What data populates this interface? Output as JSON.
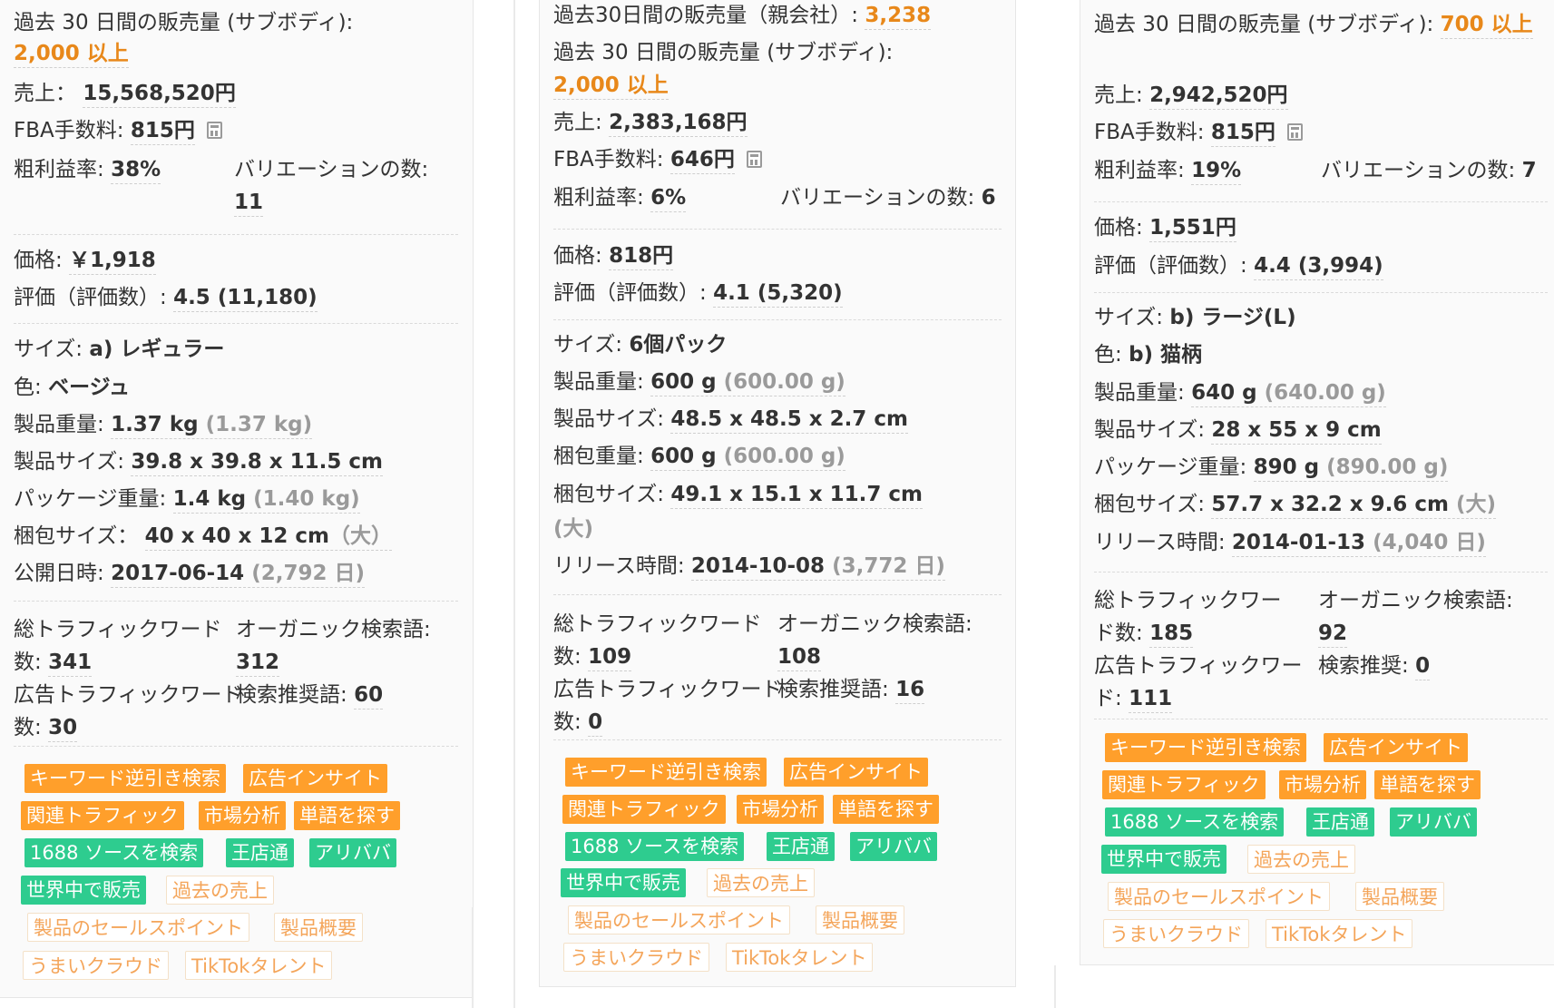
{
  "card1": {
    "sales30_label": "過去 30 日間の販売量 (サブボディ):",
    "sales30_value": "2,000 以上",
    "revenue_label": "売上：",
    "revenue_value": "15,568,520円",
    "fba_label": "FBA手数料:",
    "fba_value": "815円",
    "margin_label": "粗利益率:",
    "margin_value": "38%",
    "variations_label": "バリエーションの数:",
    "variations_value": "11",
    "price_label": "価格:",
    "price_value": "￥1,918",
    "rating_label": "評価（評価数）:",
    "rating_value": "4.5 (11,180)",
    "size_label": "サイズ:",
    "size_value": "a) レギュラー",
    "color_label": "色:",
    "color_value": "ベージュ",
    "weight_label": "製品重量:",
    "weight_value": "1.37 kg",
    "weight_extra": "(1.37 kg)",
    "dims_label": "製品サイズ:",
    "dims_value": "39.8 x 39.8 x 11.5 cm",
    "pkg_weight_label": "パッケージ重量:",
    "pkg_weight_value": "1.4 kg",
    "pkg_weight_extra": "(1.40 kg)",
    "pkg_size_label": "梱包サイズ：",
    "pkg_size_value": "40 x 40 x 12 cm",
    "pkg_size_extra": "（大）",
    "date_label": "公開日時:",
    "date_value": "2017-06-14",
    "date_extra": "(2,792 日)",
    "traffic_label": "総トラフィックワード数:",
    "traffic_value": "341",
    "organic_label": "オーガニック検索語:",
    "organic_value": "312",
    "ad_label": "広告トラフィックワード数:",
    "ad_value": "30",
    "rec_label": "検索推奨語:",
    "rec_value": "60"
  },
  "card2": {
    "parent_sales_label": "過去30日間の販売量（親会社）:",
    "parent_sales_value": "3,238",
    "sales30_label": "過去 30 日間の販売量 (サブボディ):",
    "sales30_value": "2,000 以上",
    "revenue_label": "売上:",
    "revenue_value": "2,383,168円",
    "fba_label": "FBA手数料:",
    "fba_value": "646円",
    "margin_label": "粗利益率:",
    "margin_value": "6%",
    "variations_label": "バリエーションの数:",
    "variations_value": "6",
    "price_label": "価格:",
    "price_value": "818円",
    "rating_label": "評価（評価数）:",
    "rating_value": "4.1 (5,320)",
    "size_label": "サイズ:",
    "size_value": "6個パック",
    "weight_label": "製品重量:",
    "weight_value": "600 g",
    "weight_extra": "(600.00 g)",
    "dims_label": "製品サイズ:",
    "dims_value": "48.5 x 48.5 x 2.7 cm",
    "pkg_weight_label": "梱包重量:",
    "pkg_weight_value": "600 g",
    "pkg_weight_extra": "(600.00 g)",
    "pkg_size_label": "梱包サイズ:",
    "pkg_size_value": "49.1 x 15.1 x 11.7 cm",
    "pkg_size_extra": "(大)",
    "date_label": "リリース時間:",
    "date_value": "2014-10-08",
    "date_extra": "(3,772 日)",
    "traffic_label": "総トラフィックワード数:",
    "traffic_value": "109",
    "organic_label": "オーガニック検索語:",
    "organic_value": "108",
    "ad_label": "広告トラフィックワード数:",
    "ad_value": "0",
    "rec_label": "検索推奨語:",
    "rec_value": "16"
  },
  "card3": {
    "sales30_label": "過去 30 日間の販売量 (サブボディ):",
    "sales30_value": "700 以上",
    "revenue_label": "売上:",
    "revenue_value": "2,942,520円",
    "fba_label": "FBA手数料:",
    "fba_value": "815円",
    "margin_label": "粗利益率:",
    "margin_value": "19%",
    "variations_label": "バリエーションの数:",
    "variations_value": "7",
    "price_label": "価格:",
    "price_value": "1,551円",
    "rating_label": "評価（評価数）:",
    "rating_value": "4.4 (3,994)",
    "size_label": "サイズ:",
    "size_value": "b) ラージ(L)",
    "color_label": "色:",
    "color_value": "b) 猫柄",
    "weight_label": "製品重量:",
    "weight_value": "640 g",
    "weight_extra": "(640.00 g)",
    "dims_label": "製品サイズ:",
    "dims_value": "28 x 55 x 9 cm",
    "pkg_weight_label": "パッケージ重量:",
    "pkg_weight_value": "890 g",
    "pkg_weight_extra": "(890.00 g)",
    "pkg_size_label": "梱包サイズ:",
    "pkg_size_value": "57.7 x 32.2 x 9.6 cm",
    "pkg_size_extra": "(大)",
    "date_label": "リリース時間:",
    "date_value": "2014-01-13",
    "date_extra": "(4,040 日)",
    "traffic_label": "総トラフィックワード数:",
    "traffic_value": "185",
    "organic_label": "オーガニック検索語:",
    "organic_value": "92",
    "ad_label": "広告トラフィックワード:",
    "ad_value": "111",
    "rec_label": "検索推奨:",
    "rec_value": "0"
  },
  "tags": {
    "keyword_reverse": "キーワード逆引き検索",
    "ad_insight": "広告インサイト",
    "related_traffic": "関連トラフィック",
    "market_analysis": "市場分析",
    "find_words": "単語を探す",
    "source_1688": "1688 ソースを検索",
    "wangdiantong": "王店通",
    "alibaba": "アリババ",
    "sell_worldwide": "世界中で販売",
    "past_sales": "過去の売上",
    "selling_points": "製品のセールスポイント",
    "product_overview": "製品概要",
    "umai_cloud": "うまいクラウド",
    "tiktok_talent": "TikTokタレント"
  },
  "colors": {
    "accent_orange": "#ff9f2b",
    "accent_green": "#2ecc8f",
    "value_orange": "#e8881a"
  },
  "icons": {
    "fba_calc": "calculator-icon"
  }
}
